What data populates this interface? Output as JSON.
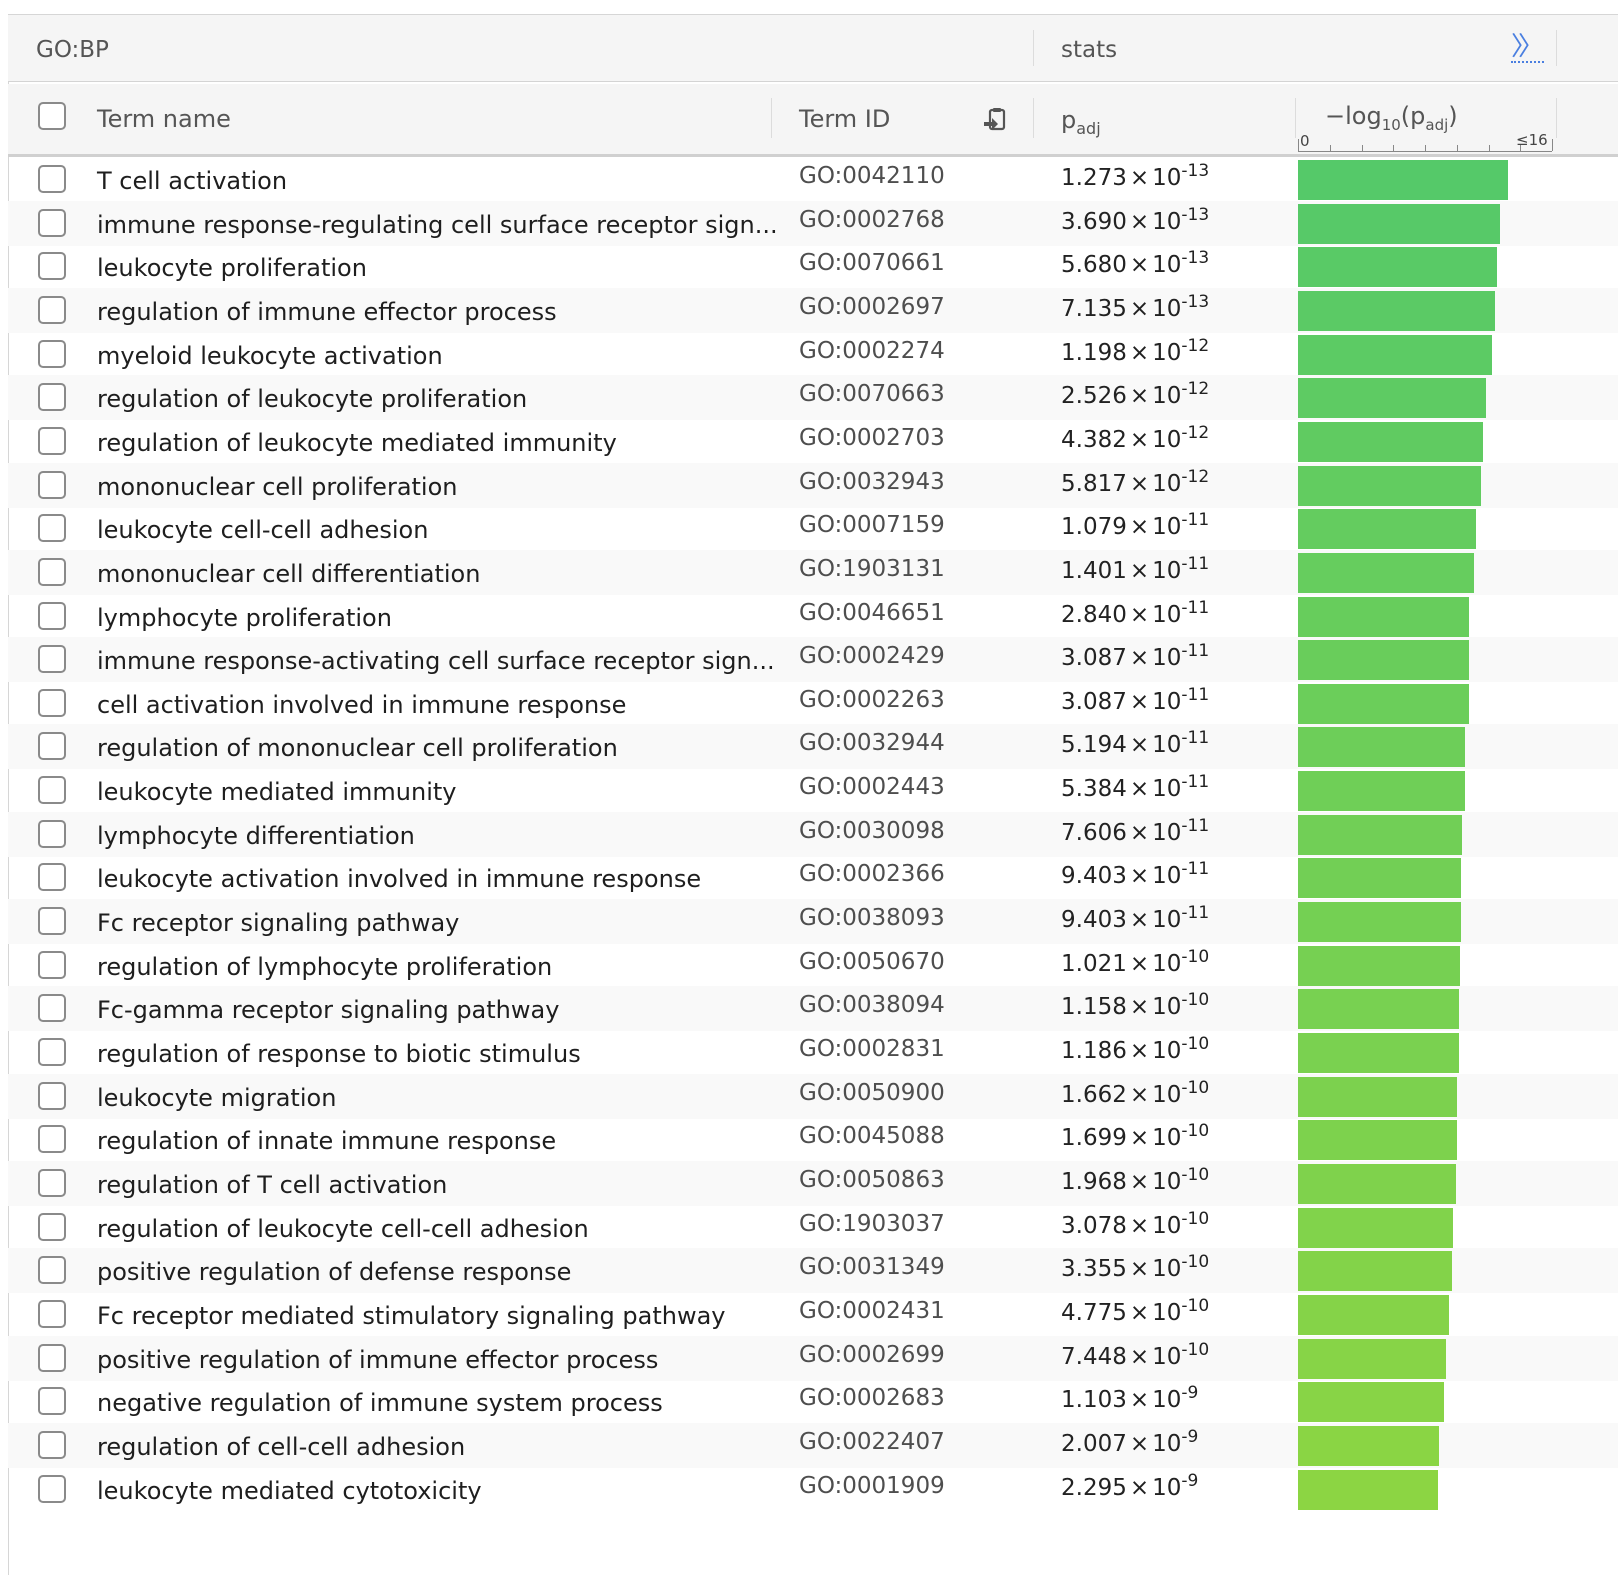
{
  "group_header": {
    "source_label": "GO:BP",
    "stats_label": "stats",
    "expand_label": "〉〉"
  },
  "columns": {
    "term_name": "Term name",
    "term_id": "Term ID",
    "padj_symbol": "p",
    "padj_subscript": "adj",
    "neglog_prefix": "−log",
    "neglog_base": "10",
    "neglog_open": "(p",
    "neglog_sub": "adj",
    "neglog_close": ")",
    "axis_min_label": "0",
    "axis_max_label": "≤16"
  },
  "colors": {
    "bar_top": "#55c969",
    "bar_bottom": "#8cd543"
  },
  "axis": {
    "min": 0,
    "max": 16
  },
  "rows": [
    {
      "name": "T cell activation",
      "id": "GO:0042110",
      "mantissa": "1.273",
      "exponent": "-13",
      "neg_log10": 12.895
    },
    {
      "name": "immune response-regulating cell surface receptor sign...",
      "id": "GO:0002768",
      "mantissa": "3.690",
      "exponent": "-13",
      "neg_log10": 12.433
    },
    {
      "name": "leukocyte proliferation",
      "id": "GO:0070661",
      "mantissa": "5.680",
      "exponent": "-13",
      "neg_log10": 12.246
    },
    {
      "name": "regulation of immune effector process",
      "id": "GO:0002697",
      "mantissa": "7.135",
      "exponent": "-13",
      "neg_log10": 12.147
    },
    {
      "name": "myeloid leukocyte activation",
      "id": "GO:0002274",
      "mantissa": "1.198",
      "exponent": "-12",
      "neg_log10": 11.922
    },
    {
      "name": "regulation of leukocyte proliferation",
      "id": "GO:0070663",
      "mantissa": "2.526",
      "exponent": "-12",
      "neg_log10": 11.598
    },
    {
      "name": "regulation of leukocyte mediated immunity",
      "id": "GO:0002703",
      "mantissa": "4.382",
      "exponent": "-12",
      "neg_log10": 11.358
    },
    {
      "name": "mononuclear cell proliferation",
      "id": "GO:0032943",
      "mantissa": "5.817",
      "exponent": "-12",
      "neg_log10": 11.235
    },
    {
      "name": "leukocyte cell-cell adhesion",
      "id": "GO:0007159",
      "mantissa": "1.079",
      "exponent": "-11",
      "neg_log10": 10.967
    },
    {
      "name": "mononuclear cell differentiation",
      "id": "GO:1903131",
      "mantissa": "1.401",
      "exponent": "-11",
      "neg_log10": 10.854
    },
    {
      "name": "lymphocyte proliferation",
      "id": "GO:0046651",
      "mantissa": "2.840",
      "exponent": "-11",
      "neg_log10": 10.547
    },
    {
      "name": "immune response-activating cell surface receptor sign...",
      "id": "GO:0002429",
      "mantissa": "3.087",
      "exponent": "-11",
      "neg_log10": 10.51
    },
    {
      "name": "cell activation involved in immune response",
      "id": "GO:0002263",
      "mantissa": "3.087",
      "exponent": "-11",
      "neg_log10": 10.51
    },
    {
      "name": "regulation of mononuclear cell proliferation",
      "id": "GO:0032944",
      "mantissa": "5.194",
      "exponent": "-11",
      "neg_log10": 10.285
    },
    {
      "name": "leukocyte mediated immunity",
      "id": "GO:0002443",
      "mantissa": "5.384",
      "exponent": "-11",
      "neg_log10": 10.269
    },
    {
      "name": "lymphocyte differentiation",
      "id": "GO:0030098",
      "mantissa": "7.606",
      "exponent": "-11",
      "neg_log10": 10.119
    },
    {
      "name": "leukocyte activation involved in immune response",
      "id": "GO:0002366",
      "mantissa": "9.403",
      "exponent": "-11",
      "neg_log10": 10.027
    },
    {
      "name": "Fc receptor signaling pathway",
      "id": "GO:0038093",
      "mantissa": "9.403",
      "exponent": "-11",
      "neg_log10": 10.027
    },
    {
      "name": "regulation of lymphocyte proliferation",
      "id": "GO:0050670",
      "mantissa": "1.021",
      "exponent": "-10",
      "neg_log10": 9.991
    },
    {
      "name": "Fc-gamma receptor signaling pathway",
      "id": "GO:0038094",
      "mantissa": "1.158",
      "exponent": "-10",
      "neg_log10": 9.936
    },
    {
      "name": "regulation of response to biotic stimulus",
      "id": "GO:0002831",
      "mantissa": "1.186",
      "exponent": "-10",
      "neg_log10": 9.926
    },
    {
      "name": "leukocyte migration",
      "id": "GO:0050900",
      "mantissa": "1.662",
      "exponent": "-10",
      "neg_log10": 9.779
    },
    {
      "name": "regulation of innate immune response",
      "id": "GO:0045088",
      "mantissa": "1.699",
      "exponent": "-10",
      "neg_log10": 9.77
    },
    {
      "name": "regulation of T cell activation",
      "id": "GO:0050863",
      "mantissa": "1.968",
      "exponent": "-10",
      "neg_log10": 9.706
    },
    {
      "name": "regulation of leukocyte cell-cell adhesion",
      "id": "GO:1903037",
      "mantissa": "3.078",
      "exponent": "-10",
      "neg_log10": 9.512
    },
    {
      "name": "positive regulation of defense response",
      "id": "GO:0031349",
      "mantissa": "3.355",
      "exponent": "-10",
      "neg_log10": 9.474
    },
    {
      "name": "Fc receptor mediated stimulatory signaling pathway",
      "id": "GO:0002431",
      "mantissa": "4.775",
      "exponent": "-10",
      "neg_log10": 9.321
    },
    {
      "name": "positive regulation of immune effector process",
      "id": "GO:0002699",
      "mantissa": "7.448",
      "exponent": "-10",
      "neg_log10": 9.128
    },
    {
      "name": "negative regulation of immune system process",
      "id": "GO:0002683",
      "mantissa": "1.103",
      "exponent": "-9",
      "neg_log10": 8.957
    },
    {
      "name": "regulation of cell-cell adhesion",
      "id": "GO:0022407",
      "mantissa": "2.007",
      "exponent": "-9",
      "neg_log10": 8.697
    },
    {
      "name": "leukocyte mediated cytotoxicity",
      "id": "GO:0001909",
      "mantissa": "2.295",
      "exponent": "-9",
      "neg_log10": 8.639
    }
  ]
}
